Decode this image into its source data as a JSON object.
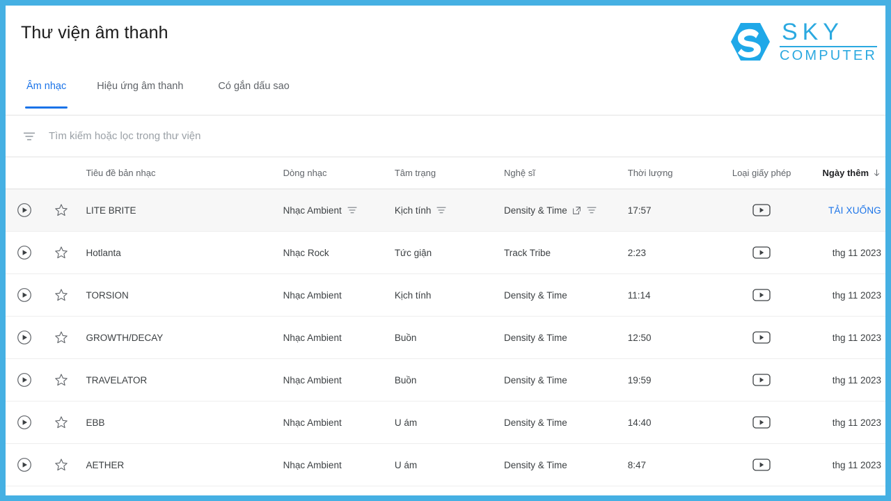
{
  "theme": {
    "border_blue": "#45B0E3",
    "accent_blue": "#1a73e8",
    "logo_blue": "#2BA9E0"
  },
  "header": {
    "title": "Thư viện âm thanh",
    "logo": {
      "mark": "hexagon-s-icon",
      "line1": "SKY",
      "line2": "COMPUTER"
    }
  },
  "tabs": [
    {
      "label": "Âm nhạc",
      "active": true,
      "name": "tab-am-nhac"
    },
    {
      "label": "Hiệu ứng âm thanh",
      "active": false,
      "name": "tab-hieu-ung-am-thanh"
    },
    {
      "label": "Có gắn dấu sao",
      "active": false,
      "name": "tab-co-gan-dau-sao"
    }
  ],
  "search": {
    "icon": "filter-list-icon",
    "placeholder": "Tìm kiếm hoặc lọc trong thư viện",
    "value": ""
  },
  "table": {
    "columns": {
      "play": "",
      "star": "",
      "title": "Tiêu đề bản nhạc",
      "genre": "Dòng nhạc",
      "mood": "Tâm trạng",
      "artist": "Nghệ sĩ",
      "duration": "Thời lượng",
      "license": "Loại giấy phép",
      "date_added": "Ngày thêm",
      "sort_icon": "arrow-down-icon"
    },
    "download_label": "TẢI XUỐNG",
    "rows": [
      {
        "title": "LITE BRITE",
        "genre": "Nhạc Ambient",
        "mood": "Kịch tính",
        "artist": "Density & Time",
        "duration": "17:57",
        "license": "youtube-play-icon",
        "date": "TẢI XUỐNG",
        "highlight": true,
        "show_hover_icons": true
      },
      {
        "title": "Hotlanta",
        "genre": "Nhạc Rock",
        "mood": "Tức giận",
        "artist": "Track Tribe",
        "duration": "2:23",
        "license": "youtube-play-icon",
        "date": "thg 11 2023",
        "highlight": false,
        "show_hover_icons": false
      },
      {
        "title": "TORSION",
        "genre": "Nhạc Ambient",
        "mood": "Kịch tính",
        "artist": "Density & Time",
        "duration": "11:14",
        "license": "youtube-play-icon",
        "date": "thg 11 2023",
        "highlight": false,
        "show_hover_icons": false
      },
      {
        "title": "GROWTH/DECAY",
        "genre": "Nhạc Ambient",
        "mood": "Buồn",
        "artist": "Density & Time",
        "duration": "12:50",
        "license": "youtube-play-icon",
        "date": "thg 11 2023",
        "highlight": false,
        "show_hover_icons": false
      },
      {
        "title": "TRAVELATOR",
        "genre": "Nhạc Ambient",
        "mood": "Buồn",
        "artist": "Density & Time",
        "duration": "19:59",
        "license": "youtube-play-icon",
        "date": "thg 11 2023",
        "highlight": false,
        "show_hover_icons": false
      },
      {
        "title": "EBB",
        "genre": "Nhạc Ambient",
        "mood": "U ám",
        "artist": "Density & Time",
        "duration": "14:40",
        "license": "youtube-play-icon",
        "date": "thg 11 2023",
        "highlight": false,
        "show_hover_icons": false
      },
      {
        "title": "AETHER",
        "genre": "Nhạc Ambient",
        "mood": "U ám",
        "artist": "Density & Time",
        "duration": "8:47",
        "license": "youtube-play-icon",
        "date": "thg 11 2023",
        "highlight": false,
        "show_hover_icons": false
      }
    ]
  }
}
